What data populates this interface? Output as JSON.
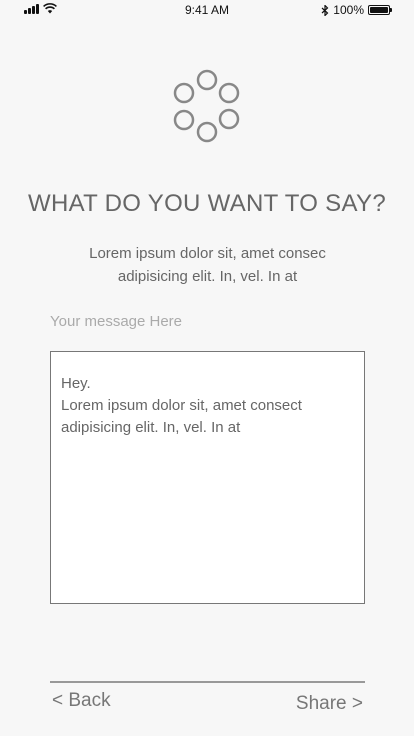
{
  "status_bar": {
    "time": "9:41 AM",
    "battery_label": "100%",
    "battery_level": 1.0
  },
  "logo": {
    "icon": "circle-ring-logo-icon"
  },
  "page": {
    "title": "WHAT DO YOU WANT TO SAY?",
    "description": "Lorem ipsum dolor sit, amet consec adipisicing elit. In, vel. In at"
  },
  "message": {
    "label": "Your message Here",
    "value": "Hey.\nLorem ipsum dolor sit, amet consect adipisicing elit. In, vel. In at"
  },
  "nav": {
    "back_label": "< Back",
    "share_label": "Share >"
  },
  "colors": {
    "background": "#f7f7f7",
    "text": "#666666",
    "placeholder": "#aaaaaa",
    "border": "#777777"
  }
}
